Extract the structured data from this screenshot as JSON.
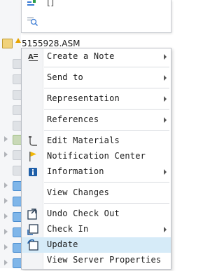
{
  "tree": {
    "root_label": "5155928.ASM"
  },
  "top_popup": {
    "bracket_text": "[]"
  },
  "context_menu": {
    "items": [
      {
        "label": "Create a Note",
        "submenu": true
      },
      {
        "label": "Send to",
        "submenu": true
      },
      {
        "label": "Representation",
        "submenu": true
      },
      {
        "label": "References",
        "submenu": true
      },
      {
        "label": "Edit Materials",
        "submenu": false
      },
      {
        "label": "Notification Center",
        "submenu": false
      },
      {
        "label": "Information",
        "submenu": true
      },
      {
        "label": "View Changes",
        "submenu": false
      },
      {
        "label": "Undo Check Out",
        "submenu": false
      },
      {
        "label": "Check In",
        "submenu": true
      },
      {
        "label": "Update",
        "submenu": false,
        "highlighted": true
      },
      {
        "label": "View Server Properties",
        "submenu": false
      }
    ]
  },
  "colors": {
    "highlight": "#d6ebf8",
    "warning": "#e6a300",
    "info": "#1f5fa8",
    "flag": "#f2b705"
  }
}
